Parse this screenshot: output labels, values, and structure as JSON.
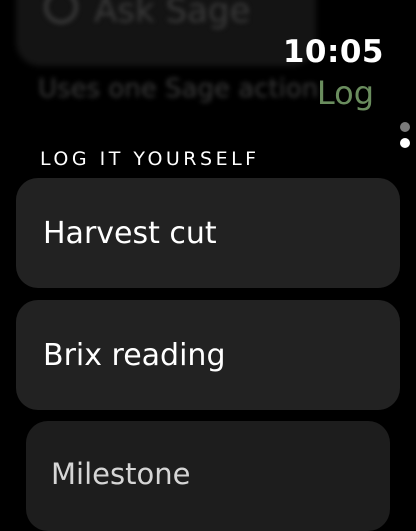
{
  "background_scroll": {
    "search_label": "Ask Sage",
    "subtitle": "Uses one Sage action"
  },
  "status_bar": {
    "time": "10:05",
    "title": "Log",
    "title_color": "#6a8d5e"
  },
  "page_indicator": {
    "pages": 2,
    "active_index": 1
  },
  "section": {
    "header": "LOG IT YOURSELF"
  },
  "actions": [
    {
      "label": "Harvest cut"
    },
    {
      "label": "Brix reading"
    },
    {
      "label": "Milestone"
    }
  ]
}
